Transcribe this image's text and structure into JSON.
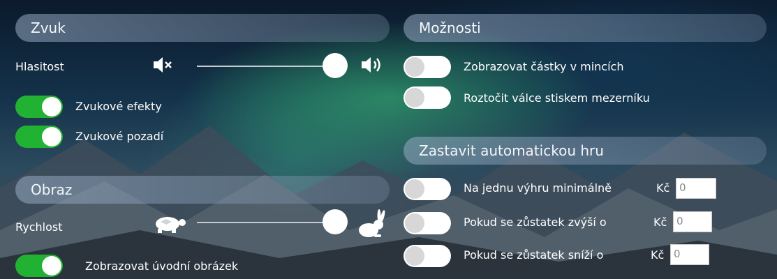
{
  "sound": {
    "header": "Zvuk",
    "volume_label": "Hlasitost",
    "volume_level": 0.9,
    "sound_effects": {
      "label": "Zvukové efekty",
      "on": true
    },
    "background_sound": {
      "label": "Zvukové pozadí",
      "on": true
    }
  },
  "image": {
    "header": "Obraz",
    "speed_label": "Rychlost",
    "speed_level": 0.9,
    "intro_image": {
      "label": "Zobrazovat úvodní obrázek",
      "on": true
    }
  },
  "options": {
    "header": "Možnosti",
    "show_coins": {
      "label": "Zobrazovat částky v mincích",
      "on": false
    },
    "spin_space": {
      "label": "Roztočit válce stiskem mezerníku",
      "on": false
    }
  },
  "autoplay": {
    "header": "Zastavit automatickou hru",
    "rows": [
      {
        "label": "Na jednu výhru minimálně",
        "currency": "Kč",
        "value": "0",
        "on": false
      },
      {
        "label": "Pokud se zůstatek zvýší o",
        "currency": "Kč",
        "value": "0",
        "on": false
      },
      {
        "label": "Pokud se zůstatek sníží o",
        "currency": "Kč",
        "value": "0",
        "on": false
      }
    ]
  },
  "icons": {
    "mute": "speaker-mute-icon",
    "volume": "speaker-volume-icon",
    "slow": "turtle-icon",
    "fast": "rabbit-icon"
  },
  "colors": {
    "toggle_on": "#22b233",
    "toggle_off": "#ffffff"
  }
}
